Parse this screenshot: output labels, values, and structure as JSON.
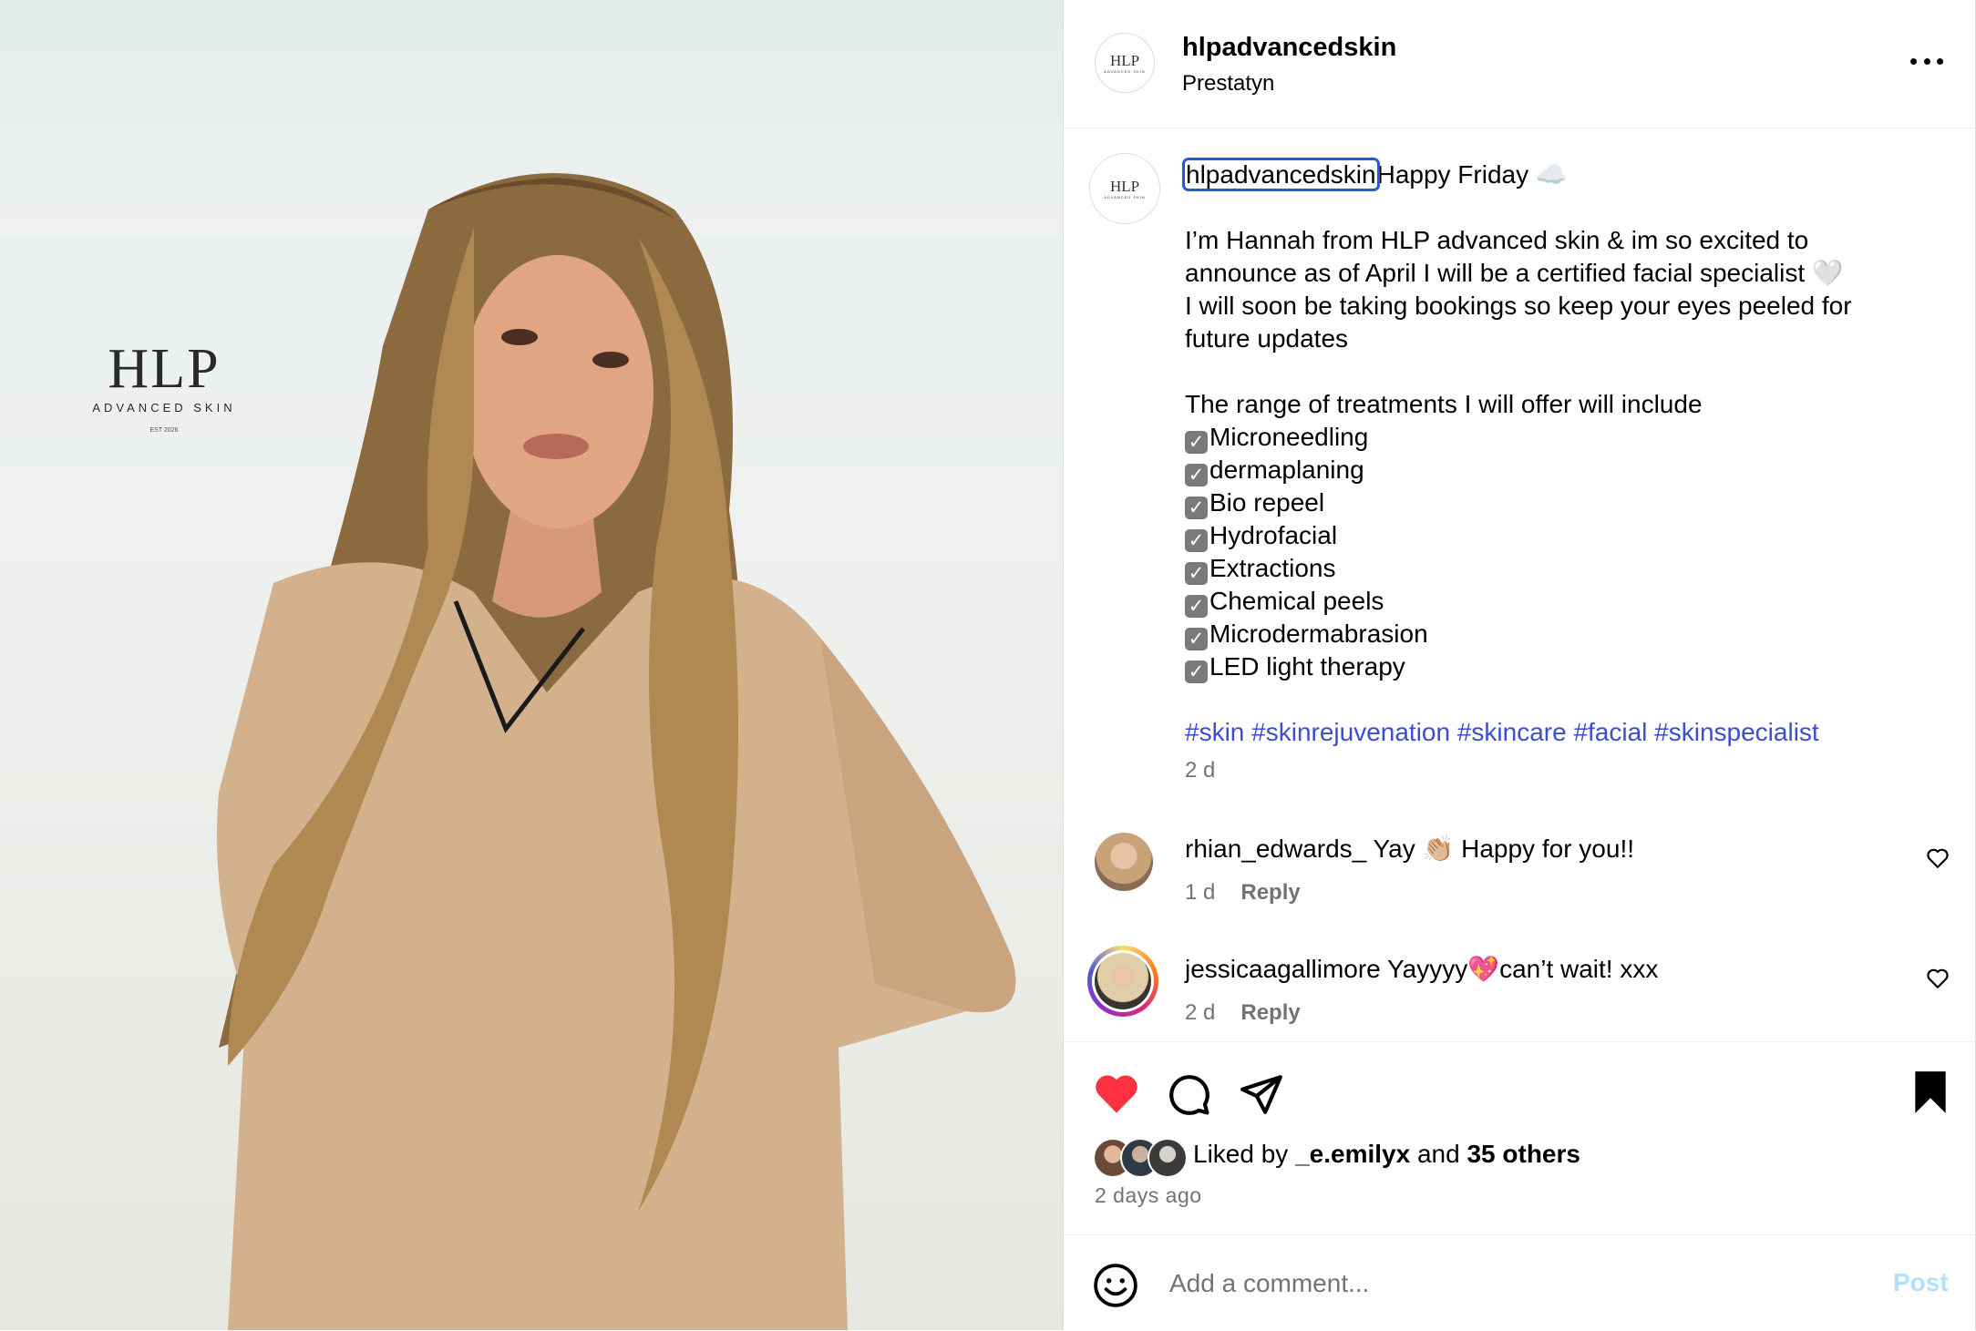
{
  "post_image": {
    "logo_mark": "HLP",
    "logo_sub": "ADVANCED SKIN",
    "logo_est": "EST 2026"
  },
  "header": {
    "username": "hlpadvancedskin",
    "location": "Prestatyn",
    "avatar_mark": "HLP",
    "avatar_sub": "ADVANCED SKIN",
    "more_icon": "more-horizontal-icon"
  },
  "caption": {
    "username": "hlpadvancedskin",
    "first_line": "Happy Friday ☁️",
    "paragraph": "I’m Hannah from HLP advanced skin & im so excited to announce as of April I will be a certified facial specialist 🤍\nI will soon be taking bookings so keep your eyes peeled for future updates",
    "list_intro": "The range of treatments I will offer will include",
    "treatments": [
      "Microneedling",
      "dermaplaning",
      "Bio repeel",
      "Hydrofacial",
      "Extractions",
      "Chemical peels",
      "Microdermabrasion",
      "LED light therapy"
    ],
    "hashtags": "#skin #skinrejuvenation #skincare #facial #skinspecialist",
    "age": "2 d"
  },
  "comments": [
    {
      "username": "rhian_edwards_",
      "text": "Yay 👏🏼 Happy for you!!",
      "age": "1 d",
      "reply": "Reply"
    },
    {
      "username": "jessicaagallimore",
      "text": "Yayyyy💖can’t wait! xxx",
      "age": "2 d",
      "reply": "Reply"
    }
  ],
  "actions": {
    "like_icon": "heart-filled-icon",
    "comment_icon": "comment-icon",
    "share_icon": "share-icon",
    "save_icon": "bookmark-filled-icon",
    "like_color": "#ff3040"
  },
  "likes": {
    "prefix": "Liked by ",
    "first_user": "_e.emilyx",
    "joiner": " and ",
    "others": "35 others"
  },
  "post_date": "2 days ago",
  "comment_box": {
    "emoji_icon": "smiley-icon",
    "placeholder": "Add a comment...",
    "post_label": "Post"
  }
}
